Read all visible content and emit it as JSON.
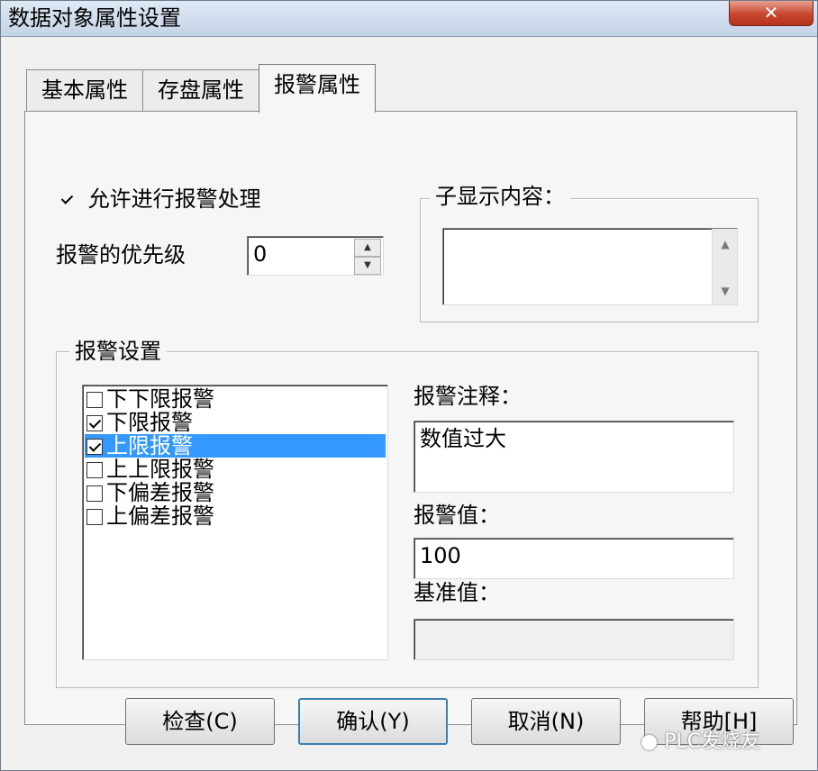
{
  "window": {
    "title": "数据对象属性设置",
    "close_label": "✕"
  },
  "tabs": [
    {
      "label": "基本属性",
      "active": false
    },
    {
      "label": "存盘属性",
      "active": false
    },
    {
      "label": "报警属性",
      "active": true
    }
  ],
  "alarm_enable": {
    "label": "允许进行报警处理",
    "checked": true
  },
  "priority": {
    "label": "报警的优先级",
    "value": "0"
  },
  "sub_display": {
    "title": "子显示内容：",
    "value": ""
  },
  "alarm_settings": {
    "title": "报警设置",
    "items": [
      {
        "label": "下下限报警",
        "checked": false,
        "selected": false
      },
      {
        "label": "下限报警",
        "checked": true,
        "selected": false
      },
      {
        "label": "上限报警",
        "checked": true,
        "selected": true
      },
      {
        "label": "上上限报警",
        "checked": false,
        "selected": false
      },
      {
        "label": "下偏差报警",
        "checked": false,
        "selected": false
      },
      {
        "label": "上偏差报警",
        "checked": false,
        "selected": false
      }
    ],
    "comment_label": "报警注释：",
    "comment_value": "数值过大",
    "value_label": "报警值：",
    "value_value": "100",
    "base_label": "基准值：",
    "base_value": ""
  },
  "buttons": {
    "check": "检查(C)",
    "confirm": "确认(Y)",
    "cancel": "取消(N)",
    "help": "帮助[H]"
  },
  "watermark": "PLC发烧友",
  "colors": {
    "selection": "#3399ff",
    "close_button": "#c7462d"
  }
}
